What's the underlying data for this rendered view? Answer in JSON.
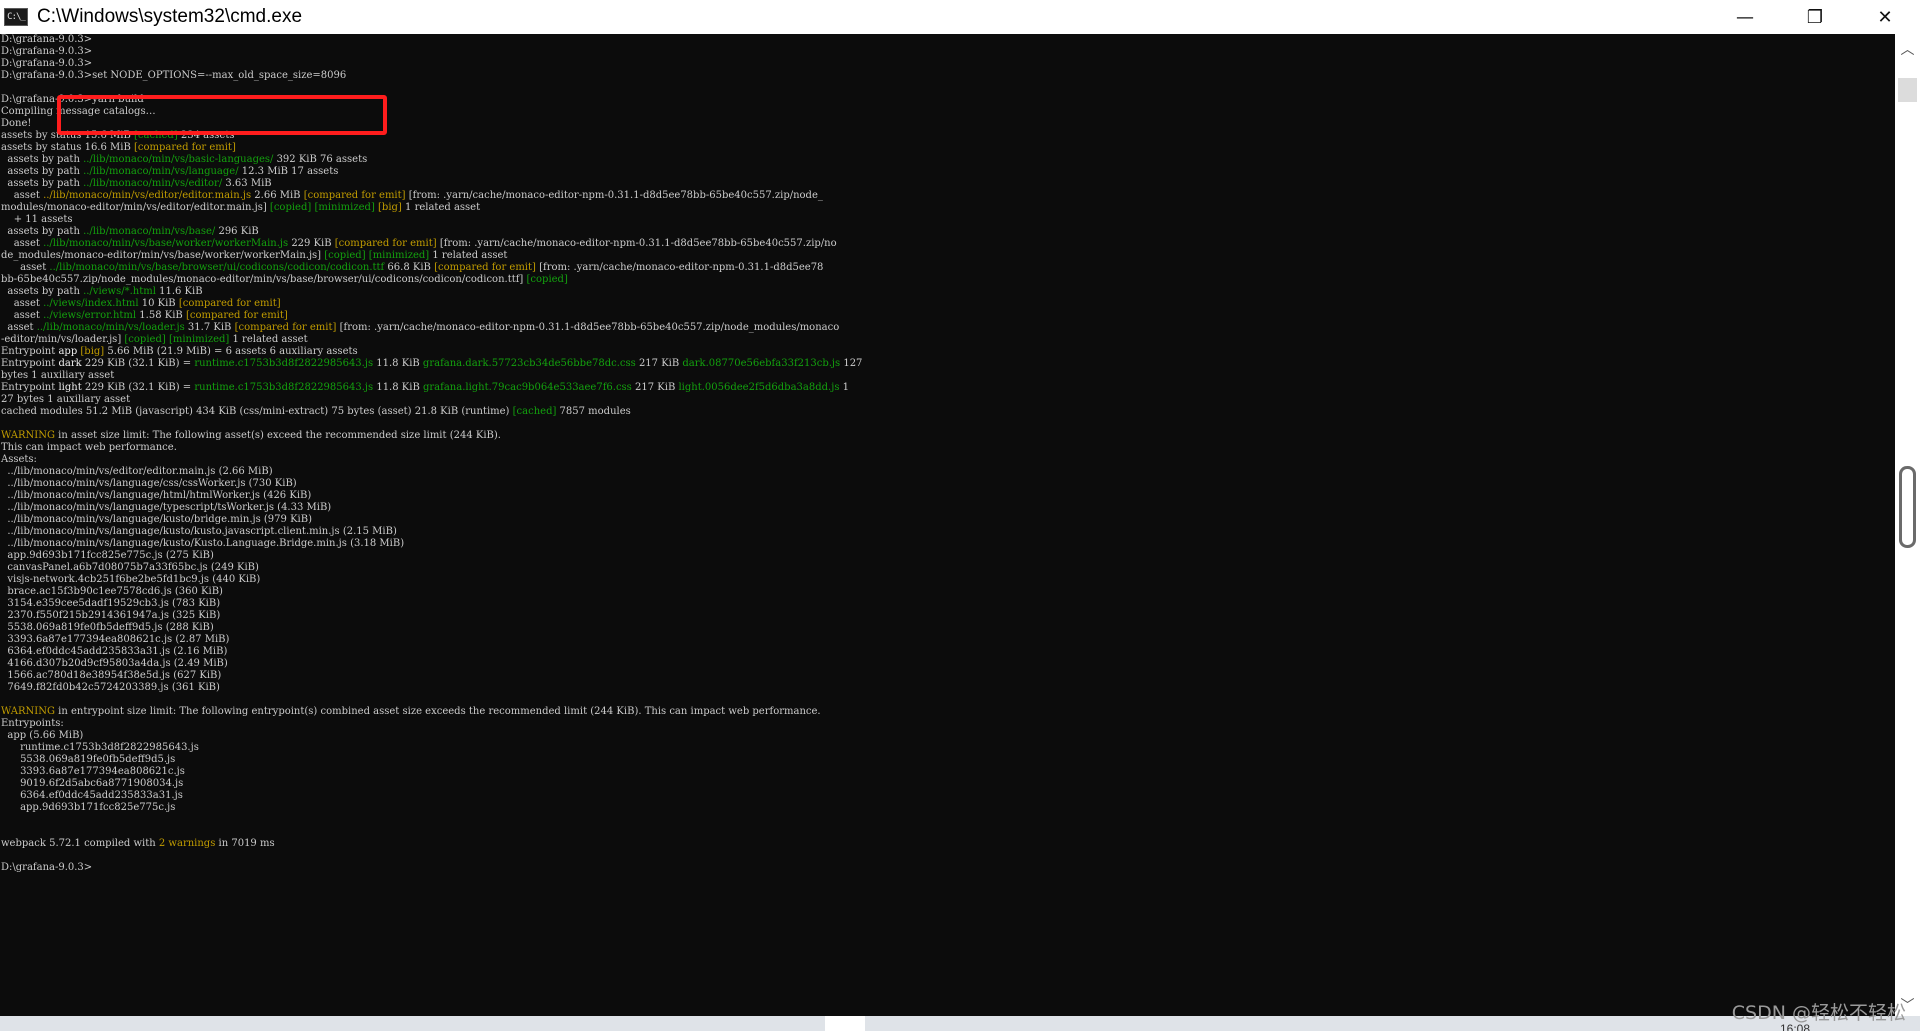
{
  "window": {
    "title": "C:\\Windows\\system32\\cmd.exe",
    "icon": "cmd-app-icon",
    "icon_glyph": "C:\\_",
    "minimize_glyph": "—",
    "maximize_glyph": "❐",
    "close_glyph": "✕"
  },
  "console": {
    "lines": [
      [
        {
          "t": "D:\\grafana-9.0.3>"
        }
      ],
      [
        {
          "t": "D:\\grafana-9.0.3>"
        }
      ],
      [
        {
          "t": "D:\\grafana-9.0.3>"
        }
      ],
      [
        {
          "t": "D:\\grafana-9.0.3>set NODE_OPTIONS=--max_old_space_size=8096"
        }
      ],
      [
        {
          "t": ""
        }
      ],
      [
        {
          "t": "D:\\grafana-9.0.3>yarn build"
        }
      ],
      [
        {
          "t": "Compiling message catalogs…"
        }
      ],
      [
        {
          "t": "Done!"
        }
      ],
      [
        {
          "t": "assets by status 15.6 MiB "
        },
        {
          "t": "[cached]",
          "c": "green"
        },
        {
          "t": " 234 assets"
        }
      ],
      [
        {
          "t": "assets by status 16.6 MiB "
        },
        {
          "t": "[compared for emit]",
          "c": "yellow"
        }
      ],
      [
        {
          "t": "  assets by path "
        },
        {
          "t": "../lib/monaco/min/vs/basic-languages/",
          "c": "green"
        },
        {
          "t": " 392 KiB 76 assets"
        }
      ],
      [
        {
          "t": "  assets by path "
        },
        {
          "t": "../lib/monaco/min/vs/language/",
          "c": "green"
        },
        {
          "t": " 12.3 MiB 17 assets"
        }
      ],
      [
        {
          "t": "  assets by path "
        },
        {
          "t": "../lib/monaco/min/vs/editor/",
          "c": "green"
        },
        {
          "t": " 3.63 MiB"
        }
      ],
      [
        {
          "t": "    asset "
        },
        {
          "t": "../lib/monaco/min/vs/editor/editor.main.js",
          "c": "yellow"
        },
        {
          "t": " 2.66 MiB "
        },
        {
          "t": "[compared for emit]",
          "c": "yellow"
        },
        {
          "t": " [from: .yarn/cache/monaco-editor-npm-0.31.1-d8d5ee78bb-65be40c557.zip/node_"
        }
      ],
      [
        {
          "t": "modules/monaco-editor/min/vs/editor/editor.main.js] "
        },
        {
          "t": "[copied]",
          "c": "green"
        },
        {
          "t": " "
        },
        {
          "t": "[minimized]",
          "c": "green"
        },
        {
          "t": " "
        },
        {
          "t": "[big]",
          "c": "yellow"
        },
        {
          "t": " 1 related asset"
        }
      ],
      [
        {
          "t": "    + 11 assets"
        }
      ],
      [
        {
          "t": "  assets by path "
        },
        {
          "t": "../lib/monaco/min/vs/base/",
          "c": "green"
        },
        {
          "t": " 296 KiB"
        }
      ],
      [
        {
          "t": "    asset "
        },
        {
          "t": "../lib/monaco/min/vs/base/worker/workerMain.js",
          "c": "green"
        },
        {
          "t": " 229 KiB "
        },
        {
          "t": "[compared for emit]",
          "c": "yellow"
        },
        {
          "t": " [from: .yarn/cache/monaco-editor-npm-0.31.1-d8d5ee78bb-65be40c557.zip/no"
        }
      ],
      [
        {
          "t": "de_modules/monaco-editor/min/vs/base/worker/workerMain.js] "
        },
        {
          "t": "[copied]",
          "c": "green"
        },
        {
          "t": " "
        },
        {
          "t": "[minimized]",
          "c": "green"
        },
        {
          "t": " 1 related asset"
        }
      ],
      [
        {
          "t": "      asset "
        },
        {
          "t": "../lib/monaco/min/vs/base/browser/ui/codicons/codicon/codicon.ttf",
          "c": "green"
        },
        {
          "t": " 66.8 KiB "
        },
        {
          "t": "[compared for emit]",
          "c": "yellow"
        },
        {
          "t": " [from: .yarn/cache/monaco-editor-npm-0.31.1-d8d5ee78"
        }
      ],
      [
        {
          "t": "bb-65be40c557.zip/node_modules/monaco-editor/min/vs/base/browser/ui/codicons/codicon/codicon.ttf] "
        },
        {
          "t": "[copied]",
          "c": "green"
        }
      ],
      [
        {
          "t": "  assets by path "
        },
        {
          "t": "../views/*.html",
          "c": "green"
        },
        {
          "t": " 11.6 KiB"
        }
      ],
      [
        {
          "t": "    asset "
        },
        {
          "t": "../views/index.html",
          "c": "green"
        },
        {
          "t": " 10 KiB "
        },
        {
          "t": "[compared for emit]",
          "c": "yellow"
        }
      ],
      [
        {
          "t": "    asset "
        },
        {
          "t": "../views/error.html",
          "c": "green"
        },
        {
          "t": " 1.58 KiB "
        },
        {
          "t": "[compared for emit]",
          "c": "yellow"
        }
      ],
      [
        {
          "t": "  asset "
        },
        {
          "t": "../lib/monaco/min/vs/loader.js",
          "c": "green"
        },
        {
          "t": " 31.7 KiB "
        },
        {
          "t": "[compared for emit]",
          "c": "yellow"
        },
        {
          "t": " [from: .yarn/cache/monaco-editor-npm-0.31.1-d8d5ee78bb-65be40c557.zip/node_modules/monaco"
        }
      ],
      [
        {
          "t": "-editor/min/vs/loader.js] "
        },
        {
          "t": "[copied]",
          "c": "green"
        },
        {
          "t": " "
        },
        {
          "t": "[minimized]",
          "c": "green"
        },
        {
          "t": " 1 related asset"
        }
      ],
      [
        {
          "t": "Entrypoint "
        },
        {
          "t": "app",
          "c": "white"
        },
        {
          "t": " "
        },
        {
          "t": "[big]",
          "c": "yellow"
        },
        {
          "t": " 5.66 MiB (21.9 MiB) = 6 assets 6 auxiliary assets"
        }
      ],
      [
        {
          "t": "Entrypoint "
        },
        {
          "t": "dark",
          "c": "white"
        },
        {
          "t": " 229 KiB (32.1 KiB) = "
        },
        {
          "t": "runtime.c1753b3d8f2822985643.js",
          "c": "green"
        },
        {
          "t": " 11.8 KiB "
        },
        {
          "t": "grafana.dark.57723cb34de56bbe78dc.css",
          "c": "green"
        },
        {
          "t": " 217 KiB "
        },
        {
          "t": "dark.08770e56ebfa33f213cb.js",
          "c": "green"
        },
        {
          "t": " 127"
        }
      ],
      [
        {
          "t": "bytes 1 auxiliary asset"
        }
      ],
      [
        {
          "t": "Entrypoint "
        },
        {
          "t": "light",
          "c": "white"
        },
        {
          "t": " 229 KiB (32.1 KiB) = "
        },
        {
          "t": "runtime.c1753b3d8f2822985643.js",
          "c": "green"
        },
        {
          "t": " 11.8 KiB "
        },
        {
          "t": "grafana.light.79cac9b064e533aee7f6.css",
          "c": "green"
        },
        {
          "t": " 217 KiB "
        },
        {
          "t": "light.0056dee2f5d6dba3a8dd.js",
          "c": "green"
        },
        {
          "t": " 1"
        }
      ],
      [
        {
          "t": "27 bytes 1 auxiliary asset"
        }
      ],
      [
        {
          "t": "cached modules 51.2 MiB (javascript) 434 KiB (css/mini-extract) 75 bytes (asset) 21.8 KiB (runtime) "
        },
        {
          "t": "[cached]",
          "c": "green"
        },
        {
          "t": " 7857 modules"
        }
      ],
      [
        {
          "t": ""
        }
      ],
      [
        {
          "t": "WARNING",
          "c": "yellow"
        },
        {
          "t": " in asset size limit: The following asset(s) exceed the recommended size limit (244 KiB)."
        }
      ],
      [
        {
          "t": "This can impact web performance."
        }
      ],
      [
        {
          "t": "Assets:"
        }
      ],
      [
        {
          "t": "  ../lib/monaco/min/vs/editor/editor.main.js (2.66 MiB)"
        }
      ],
      [
        {
          "t": "  ../lib/monaco/min/vs/language/css/cssWorker.js (730 KiB)"
        }
      ],
      [
        {
          "t": "  ../lib/monaco/min/vs/language/html/htmlWorker.js (426 KiB)"
        }
      ],
      [
        {
          "t": "  ../lib/monaco/min/vs/language/typescript/tsWorker.js (4.33 MiB)"
        }
      ],
      [
        {
          "t": "  ../lib/monaco/min/vs/language/kusto/bridge.min.js (979 KiB)"
        }
      ],
      [
        {
          "t": "  ../lib/monaco/min/vs/language/kusto/kusto.javascript.client.min.js (2.15 MiB)"
        }
      ],
      [
        {
          "t": "  ../lib/monaco/min/vs/language/kusto/Kusto.Language.Bridge.min.js (3.18 MiB)"
        }
      ],
      [
        {
          "t": "  app.9d693b171fcc825e775c.js (275 KiB)"
        }
      ],
      [
        {
          "t": "  canvasPanel.a6b7d08075b7a33f65bc.js (249 KiB)"
        }
      ],
      [
        {
          "t": "  visjs-network.4cb251f6be2be5fd1bc9.js (440 KiB)"
        }
      ],
      [
        {
          "t": "  brace.ac15f3b90c1ee7578cd6.js (360 KiB)"
        }
      ],
      [
        {
          "t": "  3154.e359cee5dadf19529cb3.js (783 KiB)"
        }
      ],
      [
        {
          "t": "  2370.f550f215b2914361947a.js (325 KiB)"
        }
      ],
      [
        {
          "t": "  5538.069a819fe0fb5deff9d5.js (288 KiB)"
        }
      ],
      [
        {
          "t": "  3393.6a87e177394ea808621c.js (2.87 MiB)"
        }
      ],
      [
        {
          "t": "  6364.ef0ddc45add235833a31.js (2.16 MiB)"
        }
      ],
      [
        {
          "t": "  4166.d307b20d9cf95803a4da.js (2.49 MiB)"
        }
      ],
      [
        {
          "t": "  1566.ac780d18e38954f38e5d.js (627 KiB)"
        }
      ],
      [
        {
          "t": "  7649.f82fd0b42c5724203389.js (361 KiB)"
        }
      ],
      [
        {
          "t": ""
        }
      ],
      [
        {
          "t": "WARNING",
          "c": "yellow"
        },
        {
          "t": " in entrypoint size limit: The following entrypoint(s) combined asset size exceeds the recommended limit (244 KiB). This can impact web performance."
        }
      ],
      [
        {
          "t": "Entrypoints:"
        }
      ],
      [
        {
          "t": "  app (5.66 MiB)"
        }
      ],
      [
        {
          "t": "      runtime.c1753b3d8f2822985643.js"
        }
      ],
      [
        {
          "t": "      5538.069a819fe0fb5deff9d5.js"
        }
      ],
      [
        {
          "t": "      3393.6a87e177394ea808621c.js"
        }
      ],
      [
        {
          "t": "      9019.6f2d5abc6a8771908034.js"
        }
      ],
      [
        {
          "t": "      6364.ef0ddc45add235833a31.js"
        }
      ],
      [
        {
          "t": "      app.9d693b171fcc825e775c.js"
        }
      ],
      [
        {
          "t": ""
        }
      ],
      [
        {
          "t": ""
        }
      ],
      [
        {
          "t": "webpack 5.72.1 compiled with "
        },
        {
          "t": "2 warnings",
          "c": "yellow"
        },
        {
          "t": " in 7019 ms"
        }
      ],
      [
        {
          "t": ""
        }
      ],
      [
        {
          "t": "D:\\grafana-9.0.3>"
        }
      ]
    ]
  },
  "overlay": {
    "highlight_color": "#ff1d1d",
    "highlight_target": "set NODE_OPTIONS=--max_old_space_size=8096"
  },
  "colors": {
    "console_background": "#0c0c0c",
    "console_text": "#cccccc",
    "green": "#13a10e",
    "yellow": "#c19c00"
  },
  "scrollbar": {
    "up_glyph": "︿",
    "down_glyph": "﹀"
  },
  "taskbar": {
    "clock_fragment": "16:08"
  },
  "watermark": {
    "text": "CSDN @轻松不轻松"
  }
}
